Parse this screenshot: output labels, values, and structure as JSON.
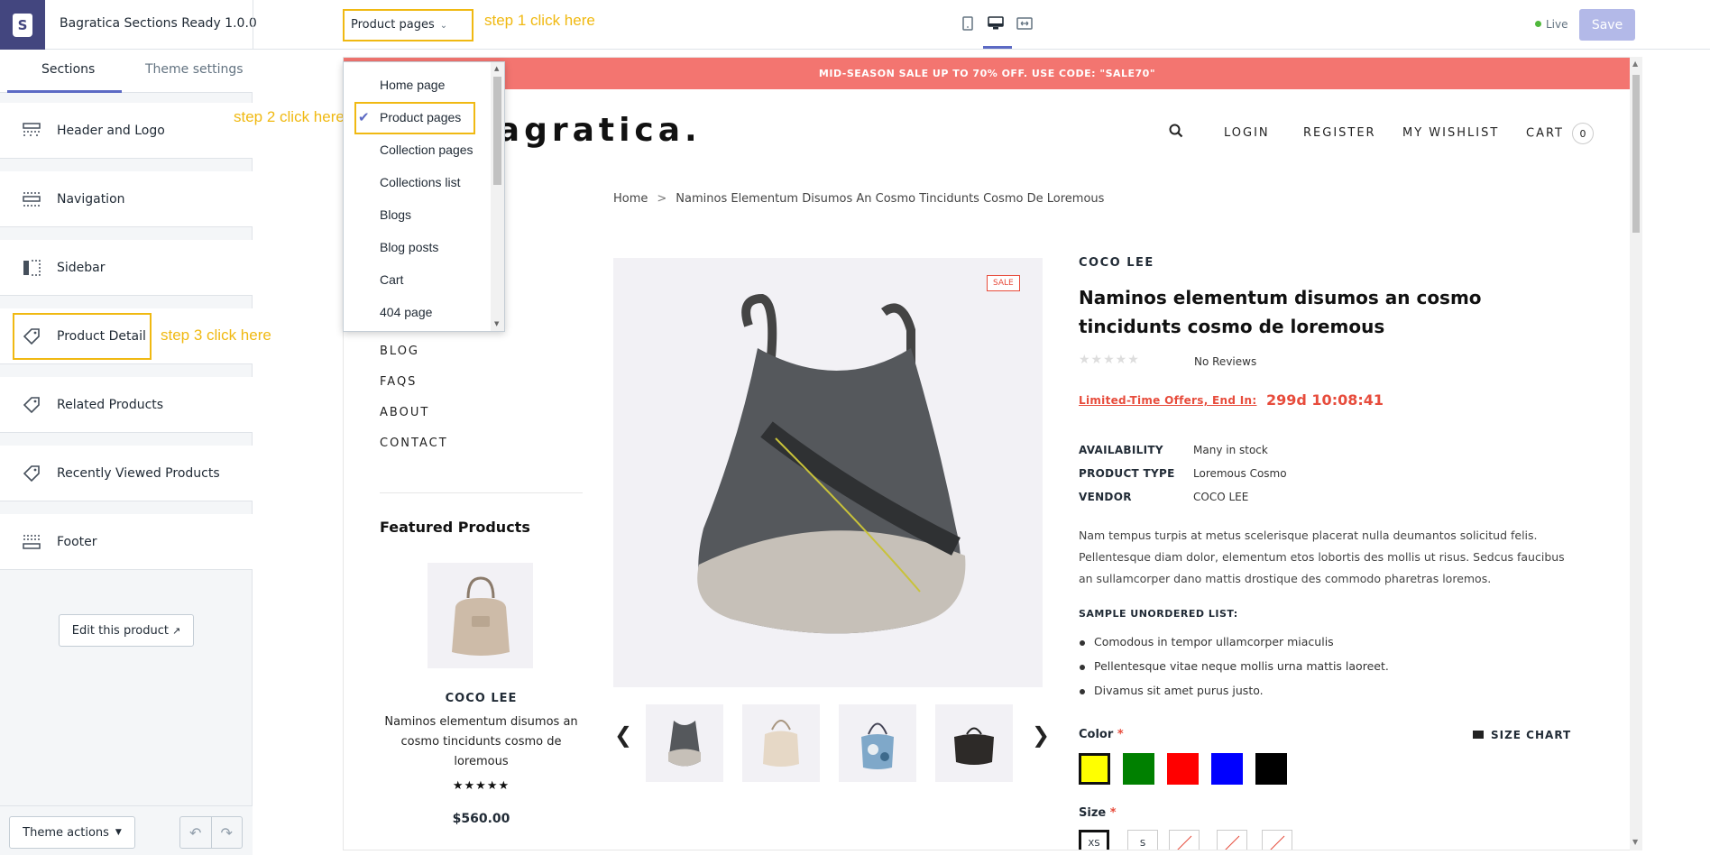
{
  "app": {
    "theme_name": "Bagratica Sections Ready 1.0.0",
    "page_selector": "Product pages",
    "live_label": "Live",
    "save_label": "Save",
    "colors": {
      "accent": "#5c6ac4",
      "annotation": "#f0b912",
      "shop_brand": "#43467f"
    }
  },
  "annotations": {
    "step1": "step 1 click here",
    "step2": "step 2 click here",
    "step3": "step 3 click here"
  },
  "sidebar": {
    "tabs": [
      "Sections",
      "Theme settings"
    ],
    "sections": [
      {
        "label": "Header and Logo",
        "icon": "header-icon"
      },
      {
        "label": "Navigation",
        "icon": "navigation-icon"
      },
      {
        "label": "Sidebar",
        "icon": "sidebar-icon"
      },
      {
        "label": "Product Detail",
        "icon": "tag-icon"
      },
      {
        "label": "Related Products",
        "icon": "tag-icon"
      },
      {
        "label": "Recently Viewed Products",
        "icon": "tag-icon"
      },
      {
        "label": "Footer",
        "icon": "footer-icon"
      }
    ],
    "edit_product": "Edit this product",
    "theme_actions": "Theme actions"
  },
  "dropdown": {
    "items": [
      "Home page",
      "Product pages",
      "Collection pages",
      "Collections list",
      "Blogs",
      "Blog posts",
      "Cart",
      "404 page"
    ],
    "selected": "Product pages"
  },
  "store": {
    "promo": "MID-SEASON SALE UP TO 70% OFF. USE CODE: \"SALE70\"",
    "logo": "bagratica.",
    "nav": {
      "login": "LOGIN",
      "register": "REGISTER",
      "wishlist": "MY WISHLIST",
      "cart": "CART",
      "cart_count": "0"
    },
    "breadcrumb": {
      "home": "Home",
      "current": "Naminos Elementum Disumos An Cosmo Tincidunts Cosmo De Loremous"
    },
    "left_links": [
      "BLOG",
      "FAQS",
      "ABOUT",
      "CONTACT"
    ],
    "featured": {
      "title": "Featured Products",
      "vendor": "COCO LEE",
      "name": "Naminos elementum disumos an cosmo tincidunts cosmo de loremous",
      "stars": "★★★★★",
      "price": "$560.00"
    },
    "product": {
      "sale_badge": "SALE",
      "vendor": "COCO LEE",
      "title": "Naminos elementum disumos an cosmo tincidunts cosmo de loremous",
      "rating_stars": "★★★★★",
      "reviews": "No Reviews",
      "offer_label": "Limited-Time Offers, End In:",
      "timer": "299d 10:08:41",
      "specs": [
        {
          "k": "AVAILABILITY",
          "v": "Many in stock"
        },
        {
          "k": "PRODUCT TYPE",
          "v": "Loremous Cosmo"
        },
        {
          "k": "VENDOR",
          "v": "COCO LEE"
        }
      ],
      "description": "Nam tempus turpis at metus scelerisque placerat nulla deumantos solicitud felis. Pellentesque diam dolor, elementum etos lobortis des mollis ut risus. Sedcus faucibus an sullamcorper dano mattis drostique des commodo pharetras loremos.",
      "list_title": "SAMPLE UNORDERED LIST:",
      "list": [
        "Comodous in tempor ullamcorper miaculis",
        "Pellentesque vitae neque mollis urna mattis laoreet.",
        "Divamus sit amet purus justo."
      ],
      "color_label": "Color",
      "required_mark": "*",
      "size_chart": "SIZE CHART",
      "colors": [
        "#ffff00",
        "#008000",
        "#ff0000",
        "#0000ff",
        "#000000"
      ],
      "size_label": "Size",
      "sizes": [
        "XS",
        "S",
        "",
        "",
        ""
      ]
    }
  }
}
